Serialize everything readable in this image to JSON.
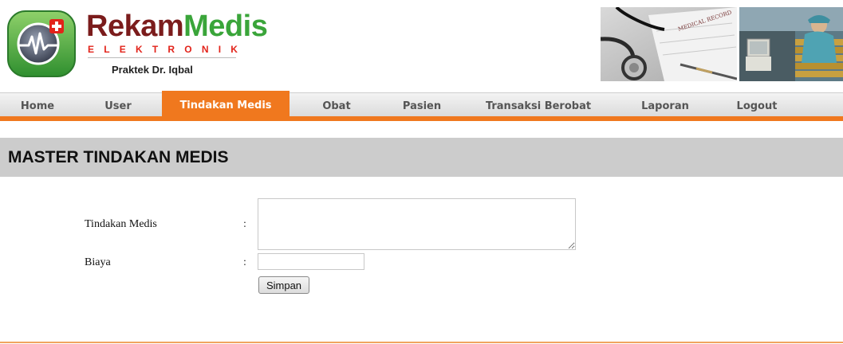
{
  "header": {
    "logo_main_part1": "Rekam",
    "logo_main_part2": "Medis",
    "logo_sub_letters": [
      "E",
      "L",
      "E",
      "K",
      "T",
      "R",
      "O",
      "N",
      "I",
      "K"
    ],
    "practice": "Praktek Dr. Iqbal",
    "photo1_caption": "MEDICAL RECORD"
  },
  "nav": {
    "items": [
      {
        "label": "Home",
        "active": false
      },
      {
        "label": "User",
        "active": false
      },
      {
        "label": "Tindakan Medis",
        "active": true
      },
      {
        "label": "Obat",
        "active": false
      },
      {
        "label": "Pasien",
        "active": false
      },
      {
        "label": "Transaksi Berobat",
        "active": false
      },
      {
        "label": "Laporan",
        "active": false
      },
      {
        "label": "Logout",
        "active": false
      }
    ],
    "accent_color": "#f0781e"
  },
  "page": {
    "title": "MASTER TINDAKAN MEDIS"
  },
  "form": {
    "tindakan_label": "Tindakan Medis",
    "tindakan_value": "",
    "biaya_label": "Biaya",
    "biaya_value": "",
    "colon": ":",
    "submit_label": "Simpan"
  }
}
